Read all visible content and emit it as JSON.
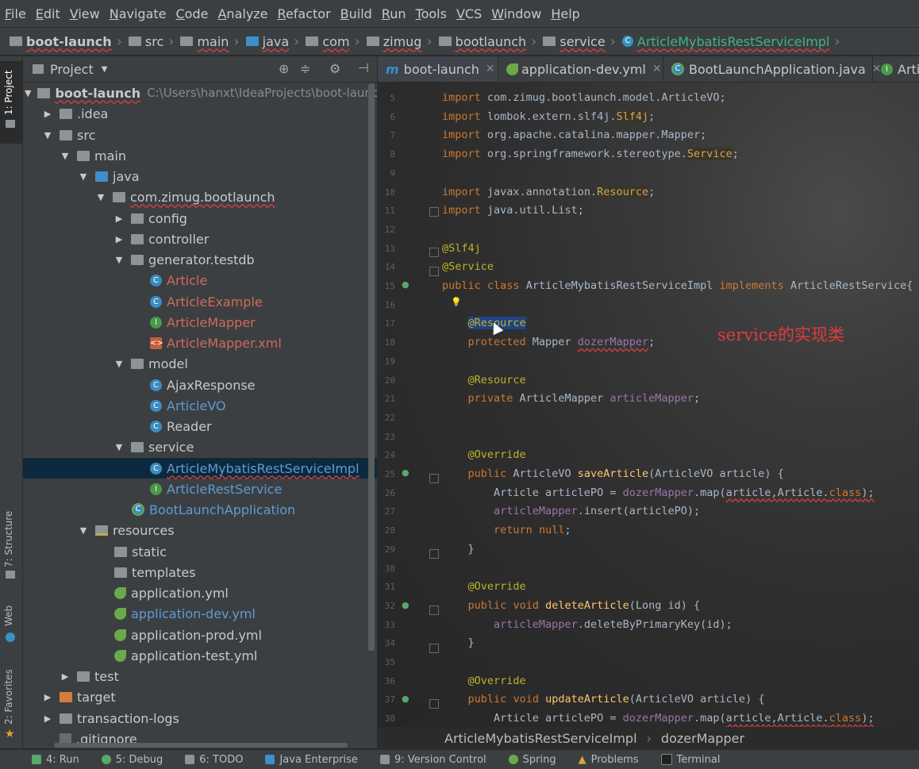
{
  "menu": [
    "File",
    "Edit",
    "View",
    "Navigate",
    "Code",
    "Analyze",
    "Refactor",
    "Build",
    "Run",
    "Tools",
    "VCS",
    "Window",
    "Help"
  ],
  "breadcrumbs": [
    "boot-launch",
    "src",
    "main",
    "java",
    "com",
    "zimug",
    "bootlaunch",
    "service",
    "ArticleMybatisRestServiceImpl"
  ],
  "left_tool_tabs": {
    "project": "1: Project",
    "structure": "7: Structure",
    "web": "Web",
    "favorites": "2: Favorites"
  },
  "project_panel": {
    "title": "Project"
  },
  "tree": [
    {
      "label": "boot-launch",
      "path": "C:\\Users\\hanxt\\IdeaProjects\\boot-launch"
    },
    {
      "label": ".idea"
    },
    {
      "label": "src"
    },
    {
      "label": "main"
    },
    {
      "label": "java"
    },
    {
      "label": "com.zimug.bootlaunch"
    },
    {
      "label": "config"
    },
    {
      "label": "controller"
    },
    {
      "label": "generator.testdb"
    },
    {
      "label": "Article"
    },
    {
      "label": "ArticleExample"
    },
    {
      "label": "ArticleMapper"
    },
    {
      "label": "ArticleMapper.xml"
    },
    {
      "label": "model"
    },
    {
      "label": "AjaxResponse"
    },
    {
      "label": "ArticleVO"
    },
    {
      "label": "Reader"
    },
    {
      "label": "service"
    },
    {
      "label": "ArticleMybatisRestServiceImpl"
    },
    {
      "label": "ArticleRestService"
    },
    {
      "label": "BootLaunchApplication"
    },
    {
      "label": "resources"
    },
    {
      "label": "static"
    },
    {
      "label": "templates"
    },
    {
      "label": "application.yml"
    },
    {
      "label": "application-dev.yml"
    },
    {
      "label": "application-prod.yml"
    },
    {
      "label": "application-test.yml"
    },
    {
      "label": "test"
    },
    {
      "label": "target"
    },
    {
      "label": "transaction-logs"
    },
    {
      "label": ".gitignore"
    }
  ],
  "editor_tabs": [
    "boot-launch",
    "application-dev.yml",
    "BootLaunchApplication.java",
    "Arti"
  ],
  "code": [
    {
      "n": "5",
      "t": "import com.zimug.bootlaunch.model.ArticleVO;"
    },
    {
      "n": "6",
      "t": "import lombok.extern.slf4j.Slf4j;"
    },
    {
      "n": "7",
      "t": "import org.apache.catalina.mapper.Mapper;"
    },
    {
      "n": "8",
      "t": "import org.springframework.stereotype.Service;"
    },
    {
      "n": "9",
      "t": ""
    },
    {
      "n": "10",
      "t": "import javax.annotation.Resource;"
    },
    {
      "n": "11",
      "t": "import java.util.List;"
    },
    {
      "n": "12",
      "t": ""
    },
    {
      "n": "13",
      "t": "@Slf4j"
    },
    {
      "n": "14",
      "t": "@Service"
    },
    {
      "n": "15",
      "t": "public class ArticleMybatisRestServiceImpl implements ArticleRestService{"
    },
    {
      "n": "16",
      "t": ""
    },
    {
      "n": "17",
      "t": "    @Resource"
    },
    {
      "n": "18",
      "t": "    protected Mapper dozerMapper;"
    },
    {
      "n": "19",
      "t": ""
    },
    {
      "n": "20",
      "t": "    @Resource"
    },
    {
      "n": "21",
      "t": "    private ArticleMapper articleMapper;"
    },
    {
      "n": "22",
      "t": ""
    },
    {
      "n": "23",
      "t": ""
    },
    {
      "n": "24",
      "t": "    @Override"
    },
    {
      "n": "25",
      "t": "    public ArticleVO saveArticle(ArticleVO article) {"
    },
    {
      "n": "26",
      "t": "        Article articlePO = dozerMapper.map(article,Article.class);"
    },
    {
      "n": "27",
      "t": "        articleMapper.insert(articlePO);"
    },
    {
      "n": "28",
      "t": "        return null;"
    },
    {
      "n": "29",
      "t": "    }"
    },
    {
      "n": "30",
      "t": ""
    },
    {
      "n": "31",
      "t": "    @Override"
    },
    {
      "n": "32",
      "t": "    public void deleteArticle(Long id) {"
    },
    {
      "n": "33",
      "t": "        articleMapper.deleteByPrimaryKey(id);"
    },
    {
      "n": "34",
      "t": "    }"
    },
    {
      "n": "35",
      "t": ""
    },
    {
      "n": "36",
      "t": "    @Override"
    },
    {
      "n": "37",
      "t": "    public void updateArticle(ArticleVO article) {"
    },
    {
      "n": "38",
      "t": "        Article articlePO = dozerMapper.map(article,Article.class);"
    }
  ],
  "annotation_note": "service的实现类",
  "editor_breadcrumb": [
    "ArticleMybatisRestServiceImpl",
    "dozerMapper"
  ],
  "bottom_tools": [
    "4: Run",
    "5: Debug",
    "6: TODO",
    "Java Enterprise",
    "9: Version Control",
    "Spring",
    "Problems",
    "Terminal"
  ],
  "icons": {
    "folder": "folder-icon",
    "class": "class-icon",
    "interface": "interface-icon",
    "spring": "spring-leaf-icon",
    "xml": "xml-icon"
  },
  "colors": {
    "accent": "#3592c4",
    "error": "#d04040",
    "note": "#e23b3b",
    "selection": "#214283"
  }
}
